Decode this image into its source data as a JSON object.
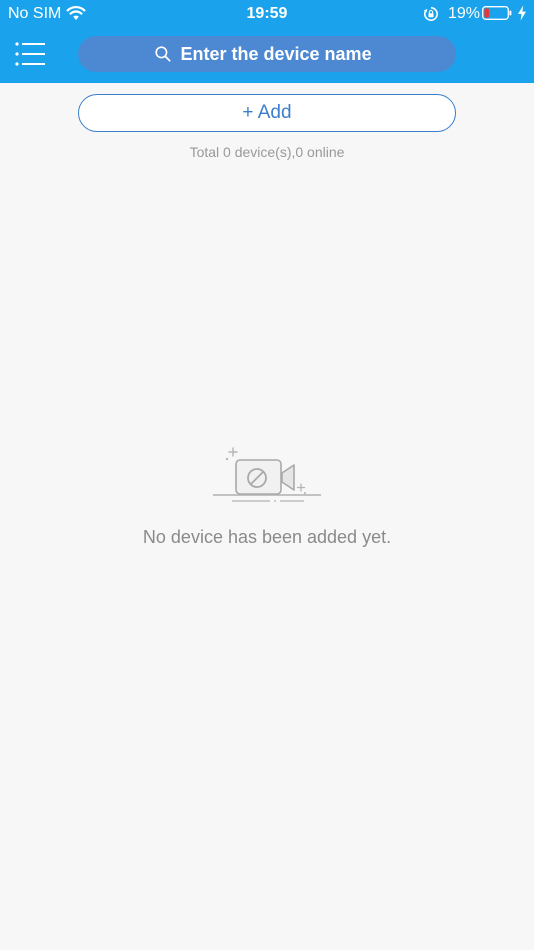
{
  "status_bar": {
    "carrier": "No SIM",
    "time": "19:59",
    "battery_percent": "19%",
    "icons": [
      "wifi-icon",
      "orientation-lock-icon",
      "battery-icon",
      "charging-icon"
    ],
    "battery_color": "#e53935"
  },
  "nav": {
    "menu_icon": "menu-icon",
    "search": {
      "placeholder": "Enter the device name",
      "value": "",
      "icon": "search-icon"
    }
  },
  "content": {
    "add_button_label": "+ Add",
    "summary": "Total 0 device(s),0 online",
    "empty_state": {
      "icon": "camera-disabled-icon",
      "message": "No device has been added yet."
    }
  },
  "colors": {
    "header_bg": "#1aa3ec",
    "search_bg": "#4d88d3",
    "accent": "#3b7fcc",
    "page_bg": "#f7f7f7",
    "muted_text": "#999999"
  }
}
